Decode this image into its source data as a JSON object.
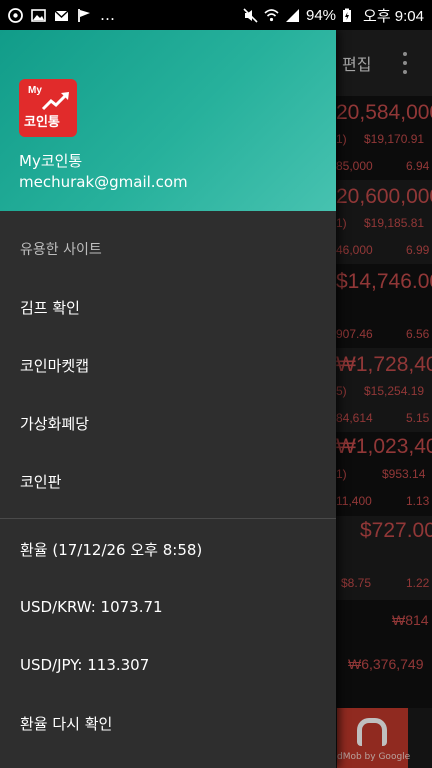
{
  "status_bar": {
    "battery": "94%",
    "time": "오후 9:04",
    "left_icons": [
      "app-notification-icon",
      "gallery-icon",
      "mail-icon",
      "flag-icon",
      "more-dots"
    ],
    "right_icons": [
      "mute-icon",
      "wifi-icon",
      "signal-icon",
      "battery-charging-icon"
    ]
  },
  "background_app": {
    "toolbar": {
      "edit_label": "편집"
    },
    "rows": [
      {
        "big": "20,584,000",
        "small_a": "1)",
        "small_b": "$19,170.91",
        "small_c": "85,000",
        "small_d": "6.94"
      },
      {
        "big": "20,600,000",
        "small_a": "1)",
        "small_b": "$19,185.81",
        "small_c": "46,000",
        "small_d": "6.99"
      },
      {
        "big": "$14,746.00",
        "small_a": "",
        "small_b": "",
        "small_c": "907.46",
        "small_d": "6.56"
      },
      {
        "big": "₩1,728,406",
        "small_a": "5)",
        "small_b": "$15,254.19",
        "small_c": "84,614",
        "small_d": "5.15"
      },
      {
        "big": "₩1,023,400",
        "small_a": "1)",
        "small_b": "$953.14",
        "small_c": "11,400",
        "small_d": "1.13"
      },
      {
        "big": "$727.00",
        "small_a": "",
        "small_b": "",
        "small_c": "$8.75",
        "small_d": "1.22"
      }
    ],
    "extra_values": [
      "₩814",
      "₩6,376,749"
    ],
    "ad_text": "dMob by Google"
  },
  "drawer": {
    "logo_text_top": "My",
    "logo_text_bottom": "코인통",
    "app_name": "My코인통",
    "email": "mechurak@gmail.com",
    "sections": [
      {
        "header": "유용한 사이트",
        "items": [
          "김프 확인",
          "코인마켓캡",
          "가상화폐당",
          "코인판"
        ]
      },
      {
        "header": "환율 (17/12/26 오후 8:58)",
        "items": [
          "USD/KRW: 1073.71",
          "USD/JPY: 113.307",
          "환율 다시 확인"
        ]
      }
    ]
  },
  "colors": {
    "header_gradient_start": "#119c89",
    "header_gradient_end": "#47c2b0",
    "drawer_bg": "#2e2e2e",
    "logo_red": "#e12b2b",
    "price_red": "#c24a4a"
  }
}
